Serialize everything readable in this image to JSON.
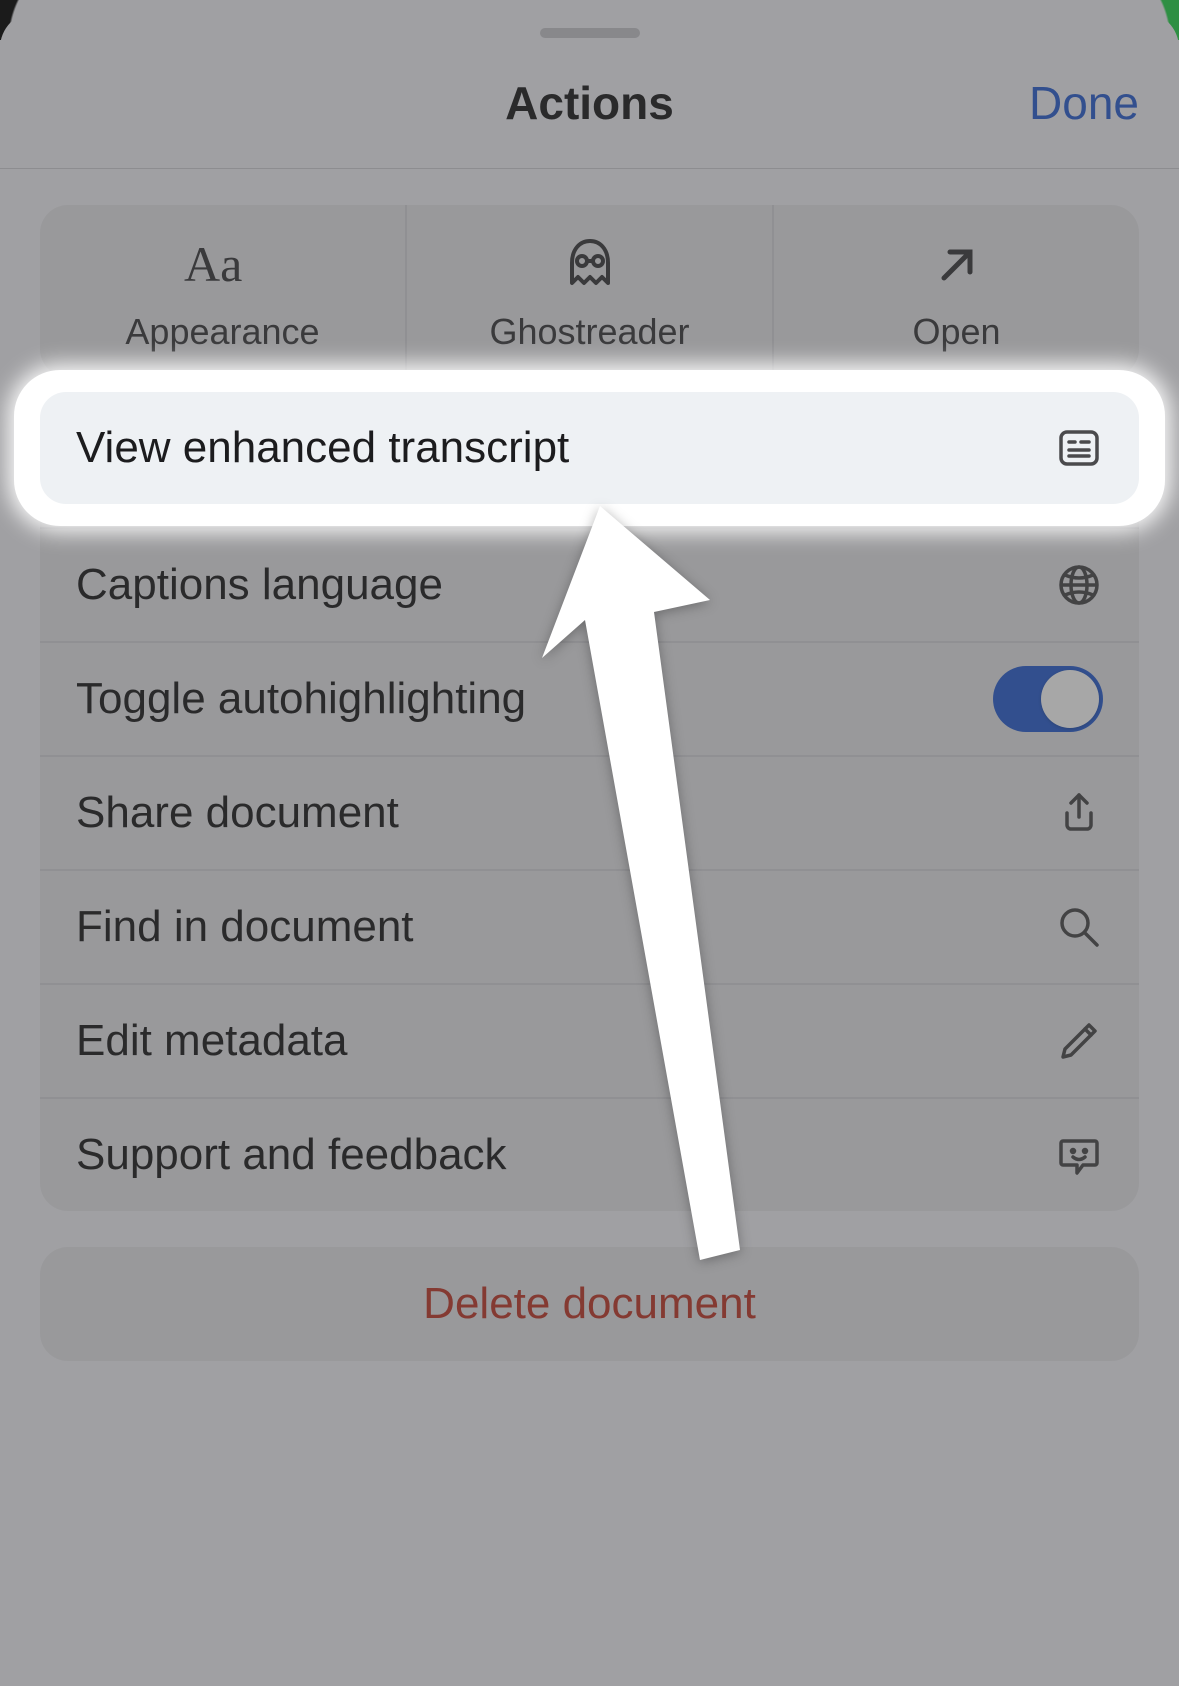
{
  "header": {
    "title": "Actions",
    "done": "Done"
  },
  "tiles": {
    "appearance": "Appearance",
    "ghostreader": "Ghostreader",
    "open": "Open"
  },
  "rows": {
    "view_transcript": "View enhanced transcript",
    "captions_language": "Captions language",
    "toggle_autohighlighting": "Toggle autohighlighting",
    "share_document": "Share document",
    "find_in_document": "Find in document",
    "edit_metadata": "Edit metadata",
    "support_feedback": "Support and feedback"
  },
  "autohighlighting_on": true,
  "danger": {
    "delete": "Delete document"
  }
}
